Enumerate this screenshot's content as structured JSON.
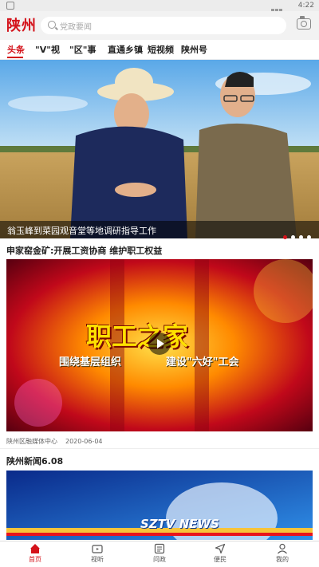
{
  "status_bar": {
    "time": "4:22"
  },
  "header": {
    "logo": "陕州",
    "search_placeholder": "党政要闻"
  },
  "tabs": [
    {
      "label": "头条",
      "active": true
    },
    {
      "label": "\"V\"视",
      "active": false
    },
    {
      "label": "\"区\"事",
      "active": false
    },
    {
      "label": "直通乡镇",
      "active": false
    },
    {
      "label": "短视频",
      "active": false
    },
    {
      "label": "陕州号",
      "active": false
    }
  ],
  "banner": {
    "caption": "翁玉峰到菜园观音堂等地调研指导工作",
    "dots": 4,
    "active_dot": 0
  },
  "news": [
    {
      "title": "申家窑金矿:开展工资协商 维护职工权益",
      "video_text": "职工之家",
      "video_subtitle_left": "围绕基层组织",
      "video_subtitle_right": "建设\"六好\"工会",
      "source": "陕州区融媒体中心",
      "date": "2020-06-04"
    },
    {
      "title": "陕州新闻6.08",
      "video_text": "SZTV NEWS"
    }
  ],
  "bottom_nav": [
    {
      "label": "首页",
      "icon": "home-icon",
      "active": true
    },
    {
      "label": "视听",
      "icon": "tv-icon",
      "active": false
    },
    {
      "label": "问政",
      "icon": "inquiry-icon",
      "active": false
    },
    {
      "label": "便民",
      "icon": "navigation-icon",
      "active": false
    },
    {
      "label": "我的",
      "icon": "user-icon",
      "active": false
    }
  ],
  "colors": {
    "accent": "#d4131b"
  }
}
